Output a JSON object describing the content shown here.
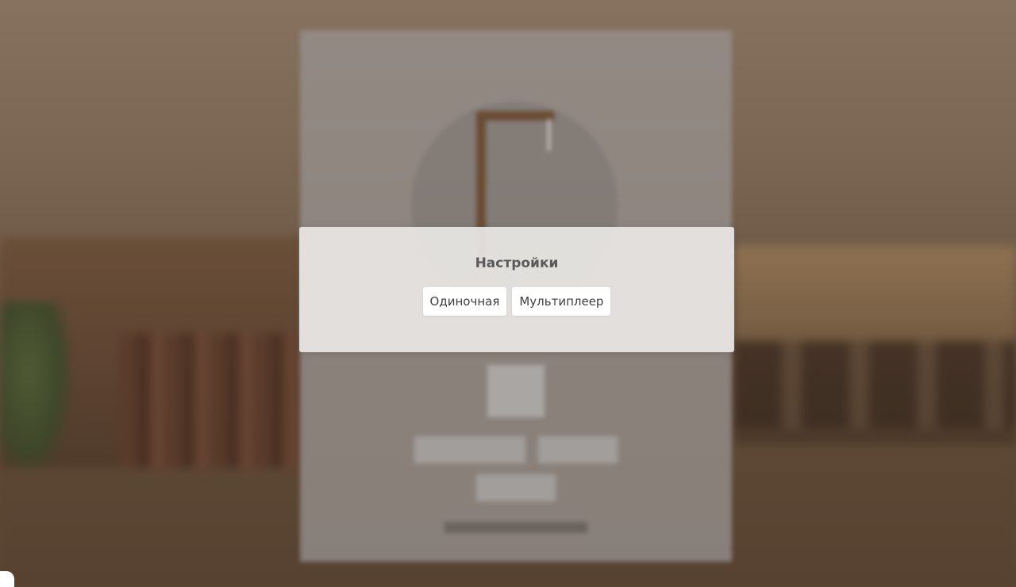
{
  "settings_modal": {
    "title": "Настройки",
    "buttons": {
      "single": "Одиночная",
      "multiplayer": "Мультиплеер"
    }
  }
}
